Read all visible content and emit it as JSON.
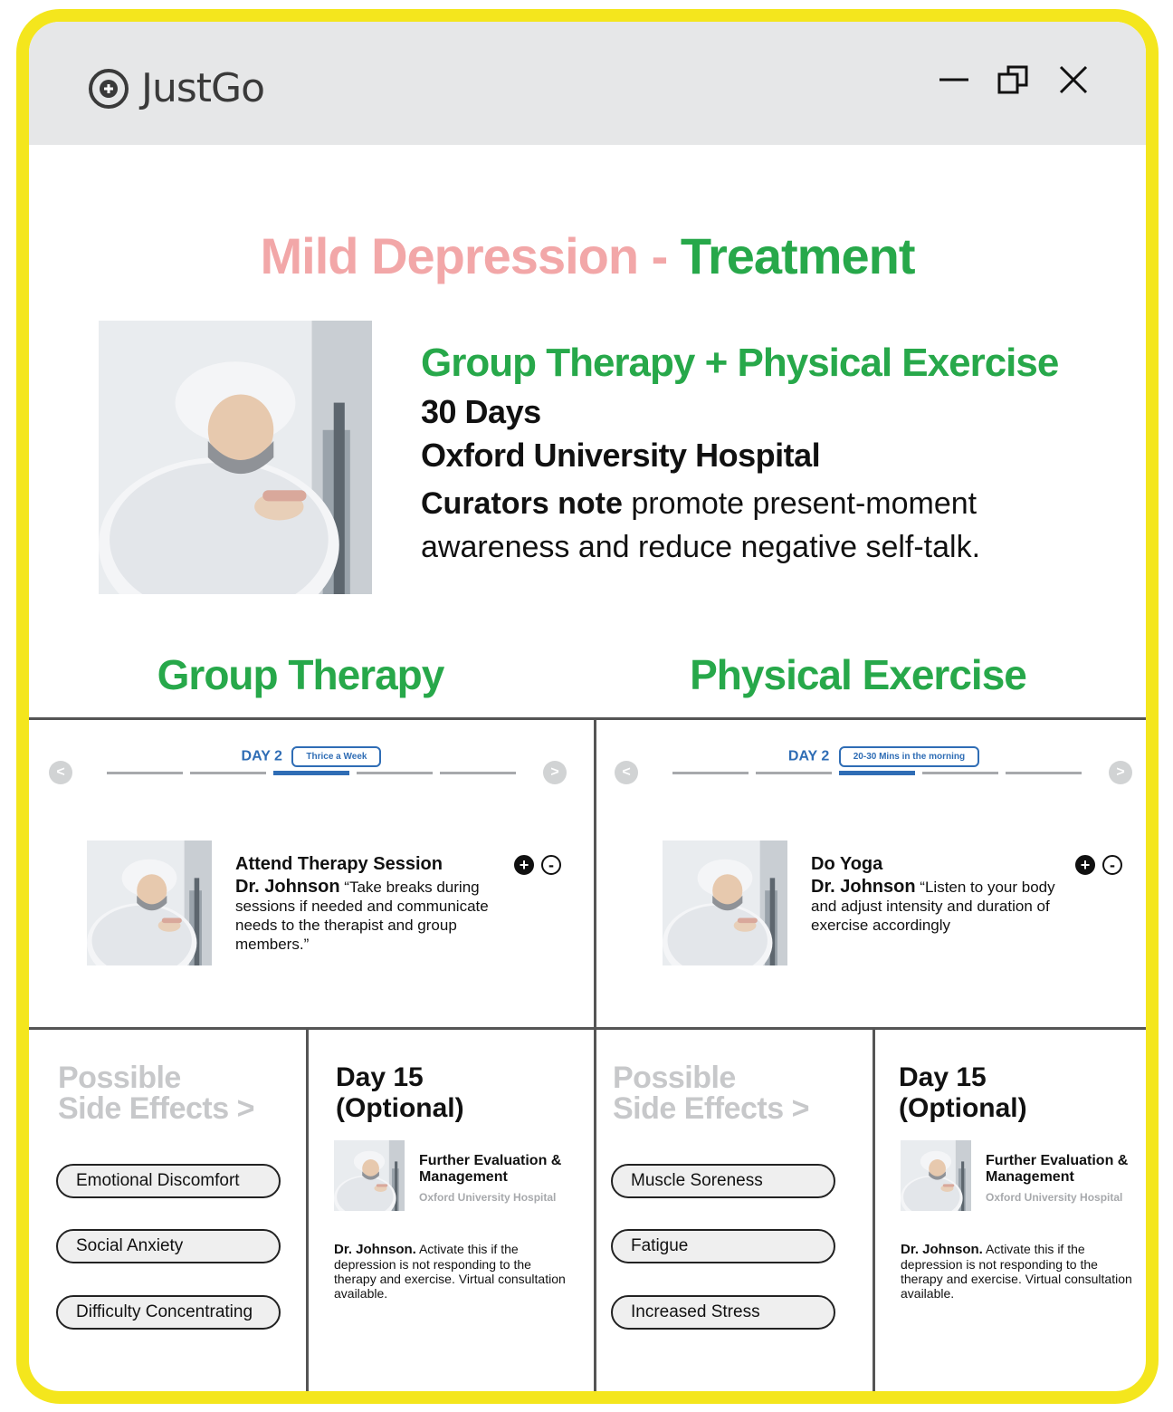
{
  "app": {
    "name": "JustGo"
  },
  "page": {
    "title_part1": "Mild Depression - ",
    "title_part2": "Treatment"
  },
  "plan": {
    "name": "Group Therapy + Physical Exercise",
    "duration": "30 Days",
    "hospital": "Oxford University Hospital",
    "note_label": "Curators note",
    "note_text": " promote present-moment awareness and reduce negative self-talk."
  },
  "columns": {
    "left_heading": "Group Therapy",
    "right_heading": "Physical Exercise"
  },
  "group_therapy": {
    "day_label": "DAY 2",
    "frequency": "Thrice a Week",
    "prev": "<",
    "next": ">",
    "progress_segments": 5,
    "active_segment": 3,
    "task_title": "Attend Therapy Session",
    "doctor": "Dr. Johnson",
    "quote": " “Take breaks during sessions if needed and communicate needs to the therapist and group members.”",
    "plus": "+",
    "minus": "-"
  },
  "physical_exercise": {
    "day_label": "DAY 2",
    "frequency": "20-30 Mins in the morning",
    "prev": "<",
    "next": ">",
    "progress_segments": 5,
    "active_segment": 3,
    "task_title": "Do Yoga",
    "doctor": "Dr. Johnson",
    "quote": " “Listen to your body and adjust intensity and duration of exercise accordingly",
    "plus": "+",
    "minus": "-"
  },
  "side_effects_left": {
    "title_line1": "Possible",
    "title_line2": "Side Effects  >",
    "items": [
      "Emotional Discomfort",
      "Social Anxiety",
      "Difficulty Concentrating"
    ]
  },
  "side_effects_right": {
    "title_line1": "Possible",
    "title_line2": "Side Effects  >",
    "items": [
      "Muscle Soreness",
      "Fatigue",
      "Increased Stress"
    ]
  },
  "day15_left": {
    "title_line1": "Day 15",
    "title_line2": "(Optional)",
    "name": "Further Evaluation & Management",
    "hospital": "Oxford University Hospital",
    "doctor": "Dr. Johnson.",
    "note": " Activate this if the depression is not responding to the therapy and exercise. Virtual consultation available."
  },
  "day15_right": {
    "title_line1": "Day 15",
    "title_line2": "(Optional)",
    "name": "Further Evaluation & Management",
    "hospital": "Oxford University Hospital",
    "doctor": "Dr. Johnson.",
    "note": " Activate this if the depression is not responding to the therapy and exercise. Virtual consultation available."
  },
  "colors": {
    "accent_green": "#27a84a",
    "title_pink": "#f2a7a8",
    "frame_yellow": "#f4e61d",
    "progress_blue": "#2f6db5",
    "muted_grey": "#c7c8ca"
  }
}
